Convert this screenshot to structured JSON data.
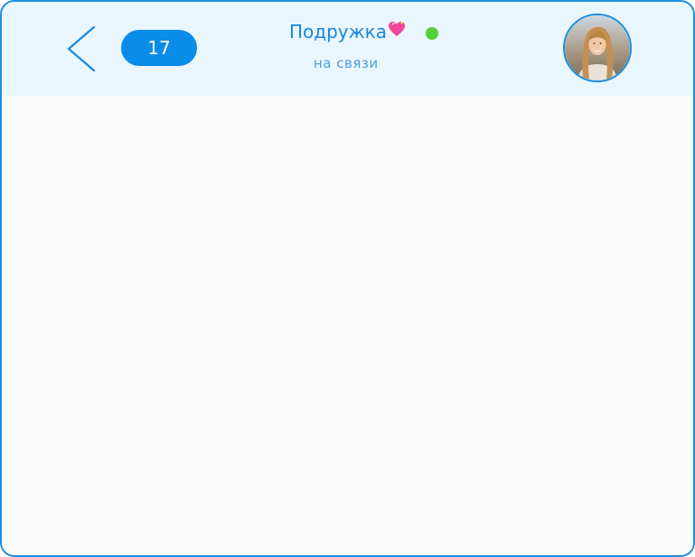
{
  "header": {
    "unread_count": "17",
    "contact_name": "Подружка",
    "status": "на связи",
    "online": true
  },
  "colors": {
    "accent": "#1c8fe3",
    "header_background": "#eaf6fe",
    "badge_background": "#0a8ce9",
    "online_indicator": "#55cf3b",
    "chat_background": "#fcfcfd"
  },
  "icons": {
    "back": "chevron-left-icon",
    "name_emoji": "sparkling-heart-icon",
    "avatar": "contact-photo"
  }
}
